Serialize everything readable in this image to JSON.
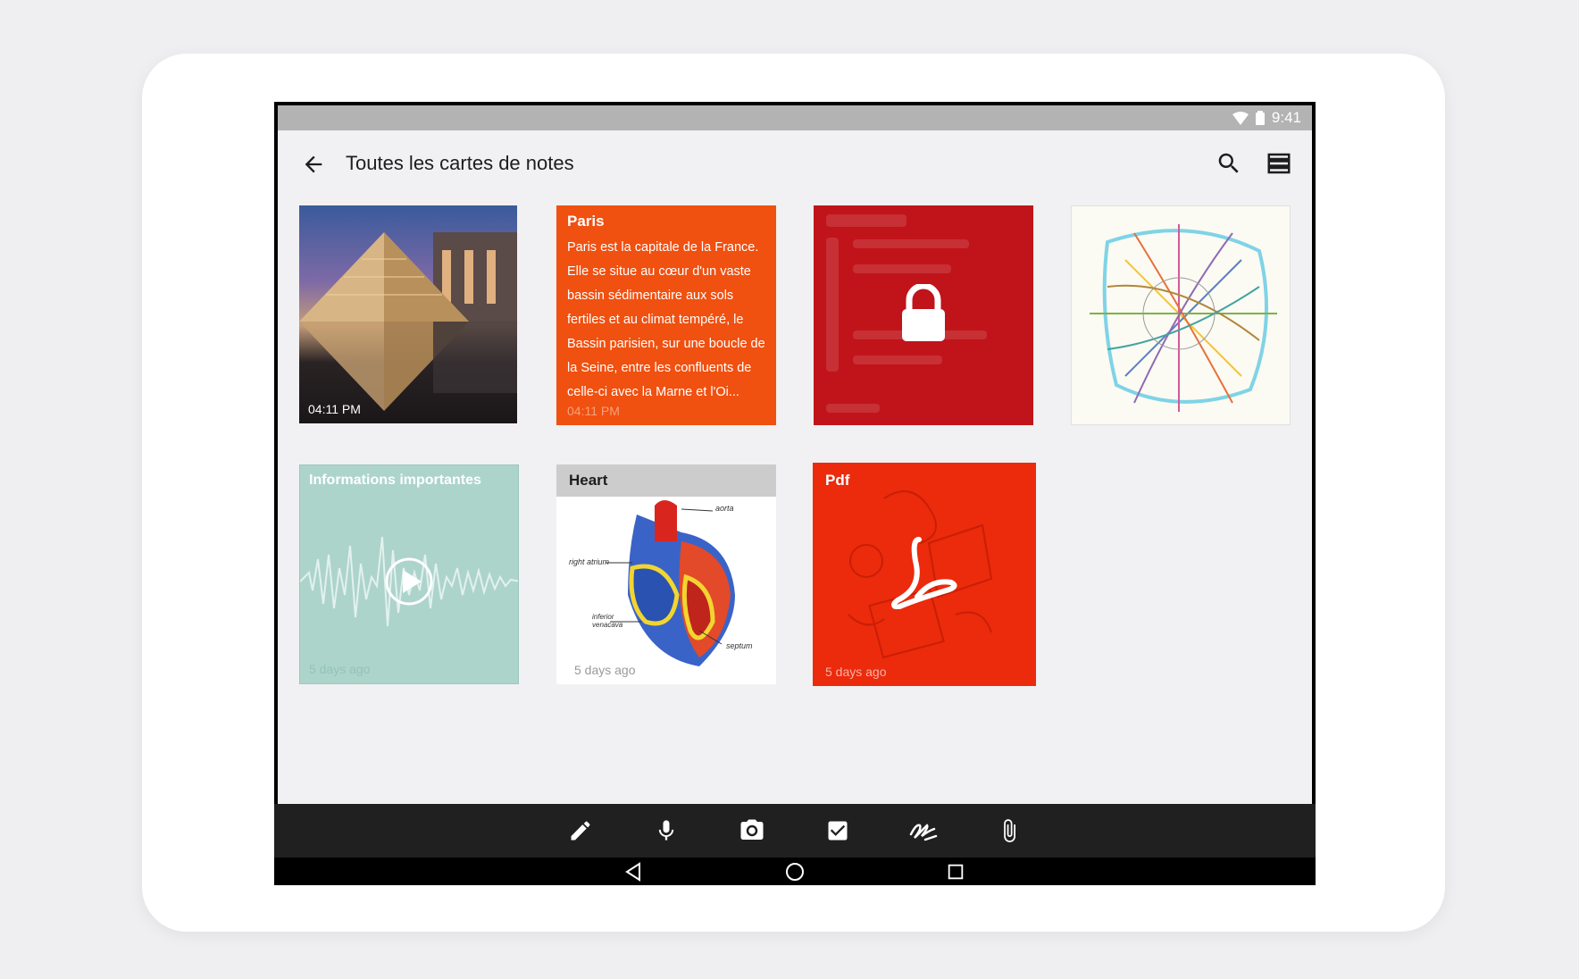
{
  "status_bar": {
    "time": "9:41"
  },
  "toolbar": {
    "title": "Toutes les cartes de notes"
  },
  "cards": {
    "photo": {
      "time": "04:11 PM"
    },
    "paris": {
      "title": "Paris",
      "body": "Paris est la capitale de la France. Elle se situe au cœur d'un vaste bassin sédimentaire aux sols fertiles et au climat tempéré, le Bassin parisien, sur une boucle de la Seine, entre les confluents de celle-ci avec la Marne et l'Oi...",
      "time": "04:11 PM"
    },
    "audio": {
      "title": "Informations importantes",
      "time": "5 days ago"
    },
    "heart": {
      "title": "Heart",
      "time": "5 days ago",
      "labels": [
        "aorta",
        "right atrium",
        "inferior venacava",
        "septum"
      ]
    },
    "pdf": {
      "title": "Pdf",
      "time": "5 days ago"
    }
  },
  "colors": {
    "paris_card": "#f05010",
    "locked_card": "#c0141a",
    "audio_card": "#add4cb",
    "pdf_card": "#ec2a0c",
    "bottom_bar": "#202020"
  },
  "bottom_tools": [
    "pencil-icon",
    "microphone-icon",
    "camera-icon",
    "checkbox-icon",
    "handwriting-icon",
    "paperclip-icon"
  ],
  "nav_buttons": [
    "back-triangle-icon",
    "home-circle-icon",
    "recents-square-icon"
  ]
}
